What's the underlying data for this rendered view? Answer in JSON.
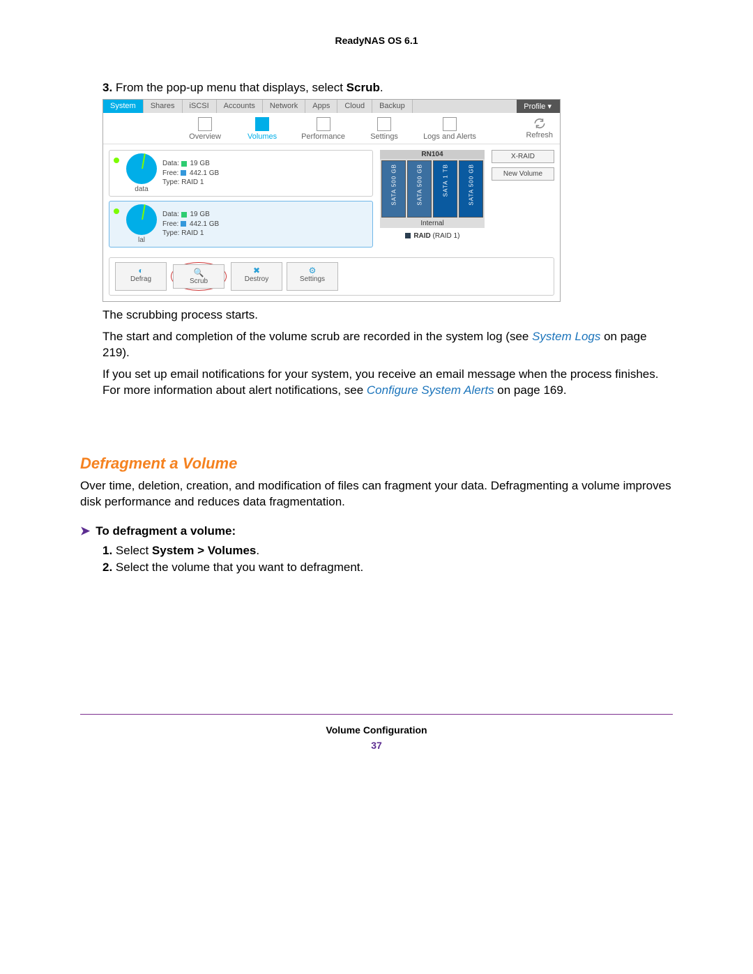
{
  "header": {
    "title": "ReadyNAS OS 6.1"
  },
  "step3": {
    "num": "3.",
    "text_a": "From the pop-up menu that displays, select ",
    "bold": "Scrub",
    "text_b": "."
  },
  "screenshot": {
    "tabs": [
      "System",
      "Shares",
      "iSCSI",
      "Accounts",
      "Network",
      "Apps",
      "Cloud",
      "Backup"
    ],
    "profile": "Profile ▾",
    "subtabs": {
      "overview": "Overview",
      "volumes": "Volumes",
      "performance": "Performance",
      "settings": "Settings",
      "logs": "Logs and Alerts",
      "refresh": "Refresh"
    },
    "vol1": {
      "name": "data",
      "data_label": "Data:",
      "data_val": "19 GB",
      "free_label": "Free:",
      "free_val": "442.1 GB",
      "type_label": "Type:",
      "type_val": "RAID 1"
    },
    "vol2": {
      "name": "lal",
      "data_label": "Data:",
      "data_val": "19 GB",
      "free_label": "Free:",
      "free_val": "442.1 GB",
      "type_label": "Type:",
      "type_val": "RAID 1"
    },
    "enclosure": {
      "title": "RN104",
      "disks": [
        "SATA 500 GB",
        "SATA 500 GB",
        "SATA 1 TB",
        "SATA 500 GB"
      ],
      "internal": "Internal",
      "raid": "RAID",
      "raid_paren": "(RAID 1)"
    },
    "side": {
      "xraid": "X-RAID",
      "newvol": "New Volume"
    },
    "actions": {
      "defrag": "Defrag",
      "scrub": "Scrub",
      "destroy": "Destroy",
      "settings": "Settings"
    }
  },
  "para1": "The scrubbing process starts.",
  "para2_a": "The start and completion of the volume scrub are recorded in the system log (see ",
  "para2_link": "System Logs",
  "para2_b": " on page 219).",
  "para3_a": "If you set up email notifications for your system, you receive an email message when the process finishes. For more information about alert notifications, see ",
  "para3_link": "Configure System Alerts",
  "para3_b": " on page 169.",
  "section": {
    "title": "Defragment a Volume"
  },
  "section_para": "Over time, deletion, creation, and modification of files can fragment your data. Defragmenting a volume improves disk performance and reduces data fragmentation.",
  "proc": {
    "arrow": "➤",
    "title": "To defragment a volume:",
    "s1": {
      "num": "1.",
      "a": "Select ",
      "b": "System > Volumes",
      "c": "."
    },
    "s2": {
      "num": "2.",
      "text": "Select the volume that you want to defragment."
    }
  },
  "footer": {
    "section": "Volume Configuration",
    "page": "37"
  }
}
